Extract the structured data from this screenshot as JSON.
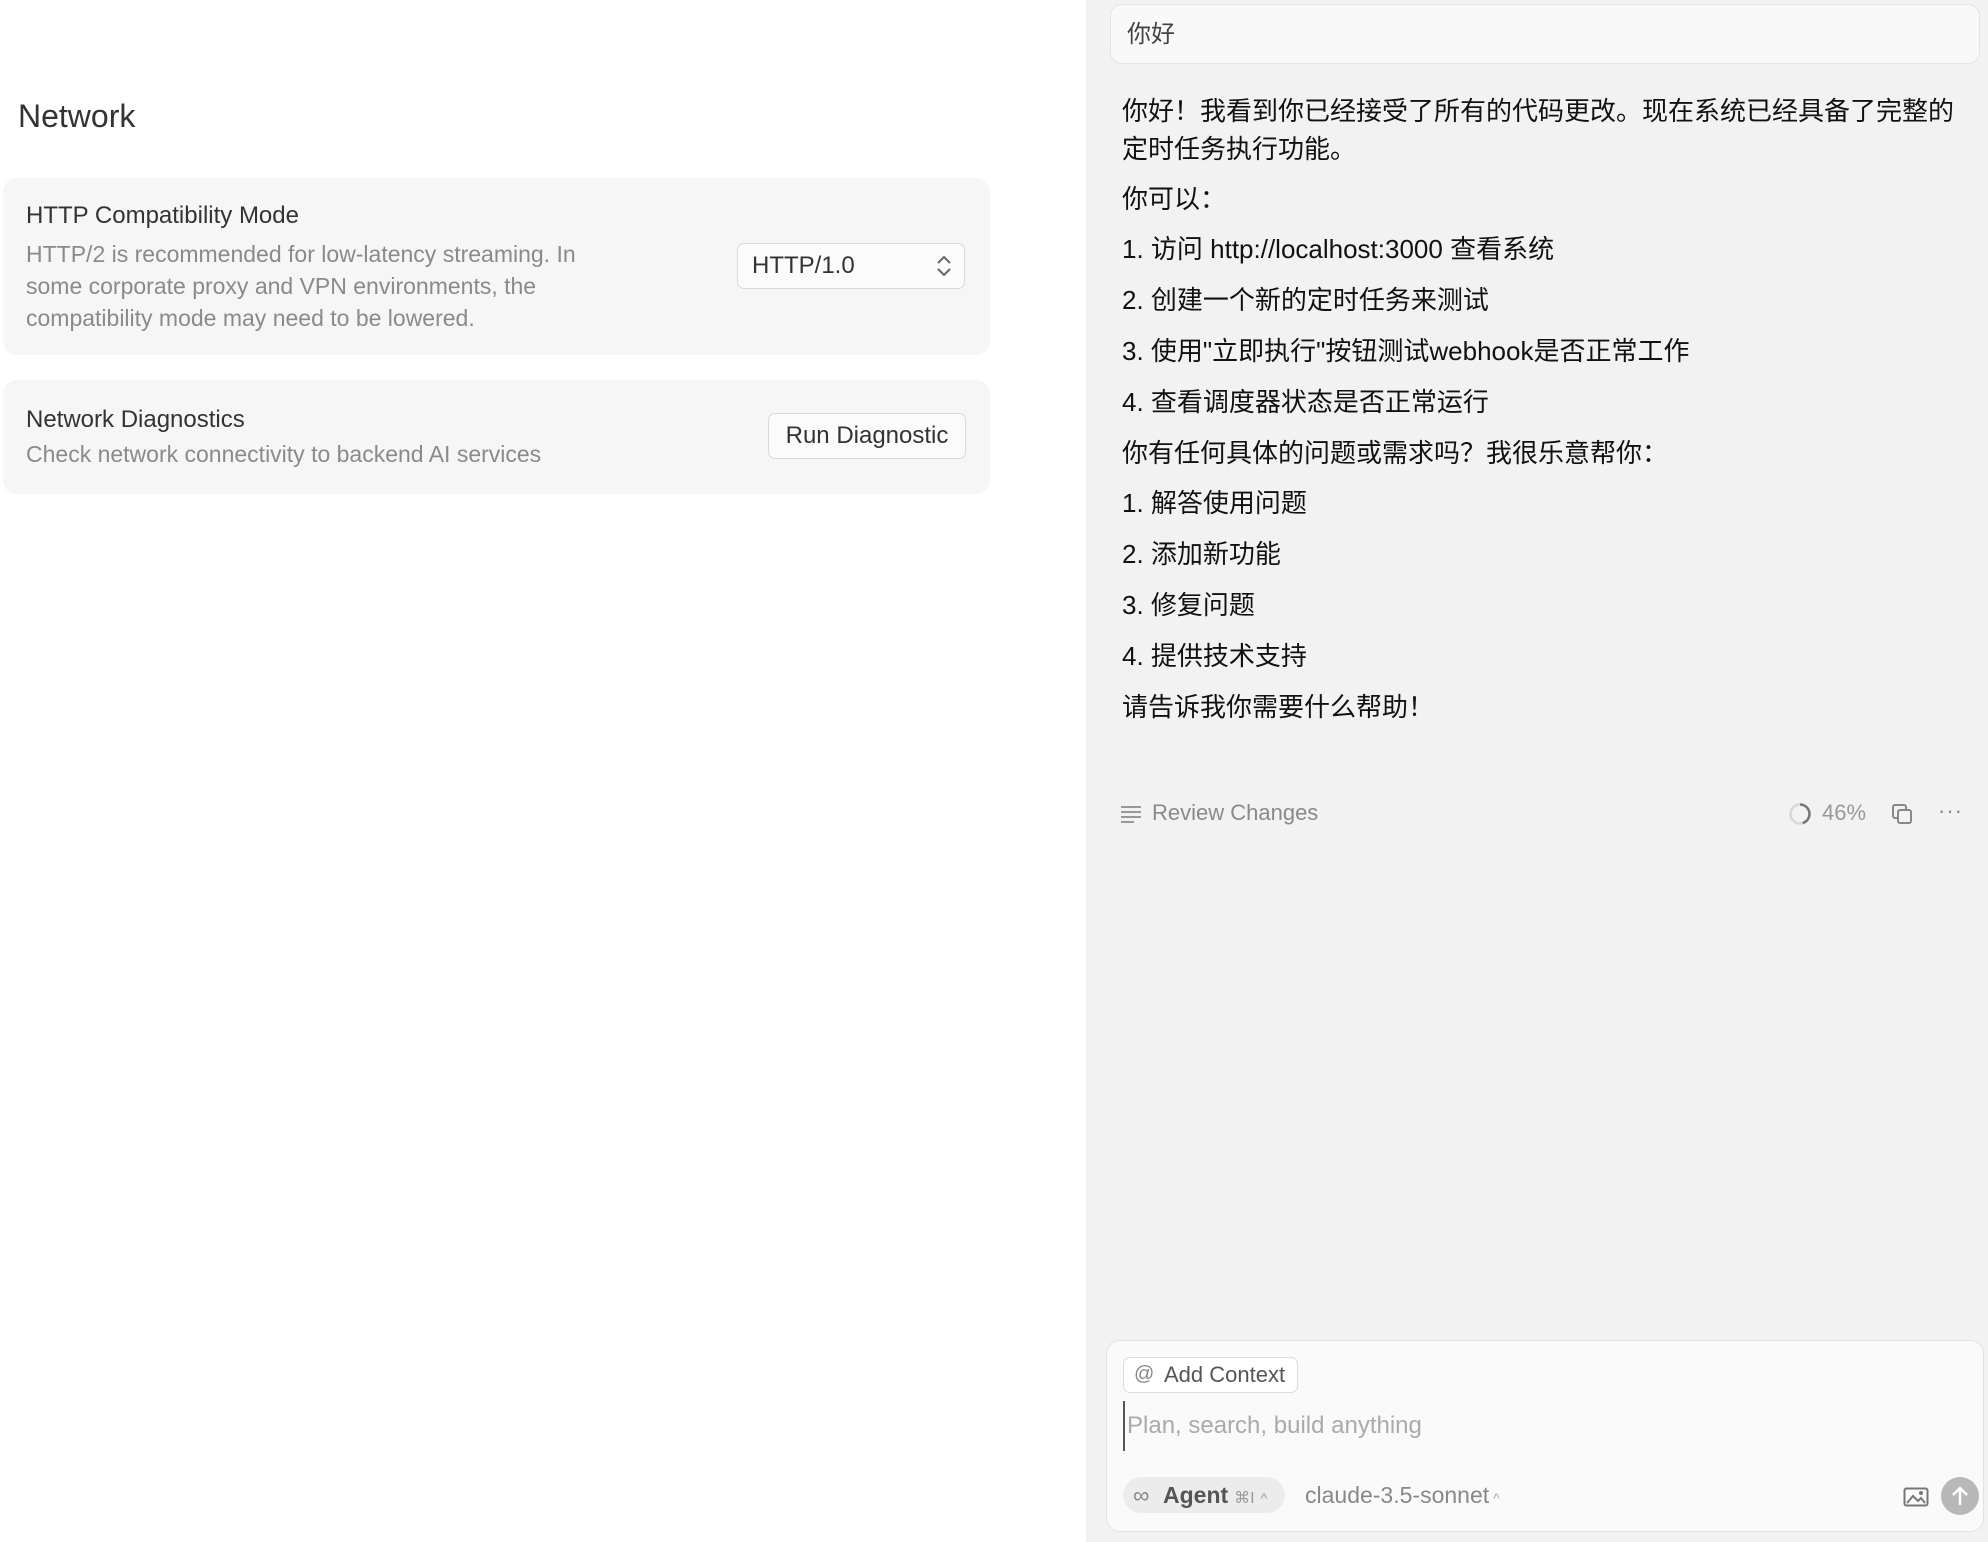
{
  "settings": {
    "section_title": "Network",
    "http_mode": {
      "title": "HTTP Compatibility Mode",
      "desc_line1": "HTTP/2 is recommended for low-latency streaming. In",
      "desc_line2": "some corporate proxy and VPN environments, the",
      "desc_line3": "compatibility mode may need to be lowered.",
      "selected": "HTTP/1.0"
    },
    "diagnostics": {
      "title": "Network Diagnostics",
      "desc": "Check network connectivity to backend AI services",
      "button_label": "Run Diagnostic"
    }
  },
  "chat": {
    "user_message": "你好",
    "reply": {
      "intro_line1": "你好！我看到你已经接受了所有的代码更改。现在系统已经具备了完整的",
      "intro_line2": "定时任务执行功能。",
      "you_can": "你可以：",
      "list1": [
        "1. 访问 http://localhost:3000 查看系统",
        "2. 创建一个新的定时任务来测试",
        "3. 使用\"立即执行\"按钮测试webhook是否正常工作",
        "4. 查看调度器状态是否正常运行"
      ],
      "question": "你有任何具体的问题或需求吗？我很乐意帮你：",
      "list2": [
        "1. 解答使用问题",
        "2. 添加新功能",
        "3. 修复问题",
        "4. 提供技术支持"
      ],
      "closing": "请告诉我你需要什么帮助！"
    },
    "review_label": "Review Changes",
    "progress_text": "46%",
    "more_label": "···"
  },
  "composer": {
    "add_context_label": "Add Context",
    "at_symbol": "@",
    "placeholder": "Plan, search, build anything",
    "agent_label": "Agent",
    "agent_symbol": "∞",
    "agent_shortcut": "⌘I",
    "caret": "^",
    "model_label": "claude-3.5-sonnet"
  }
}
